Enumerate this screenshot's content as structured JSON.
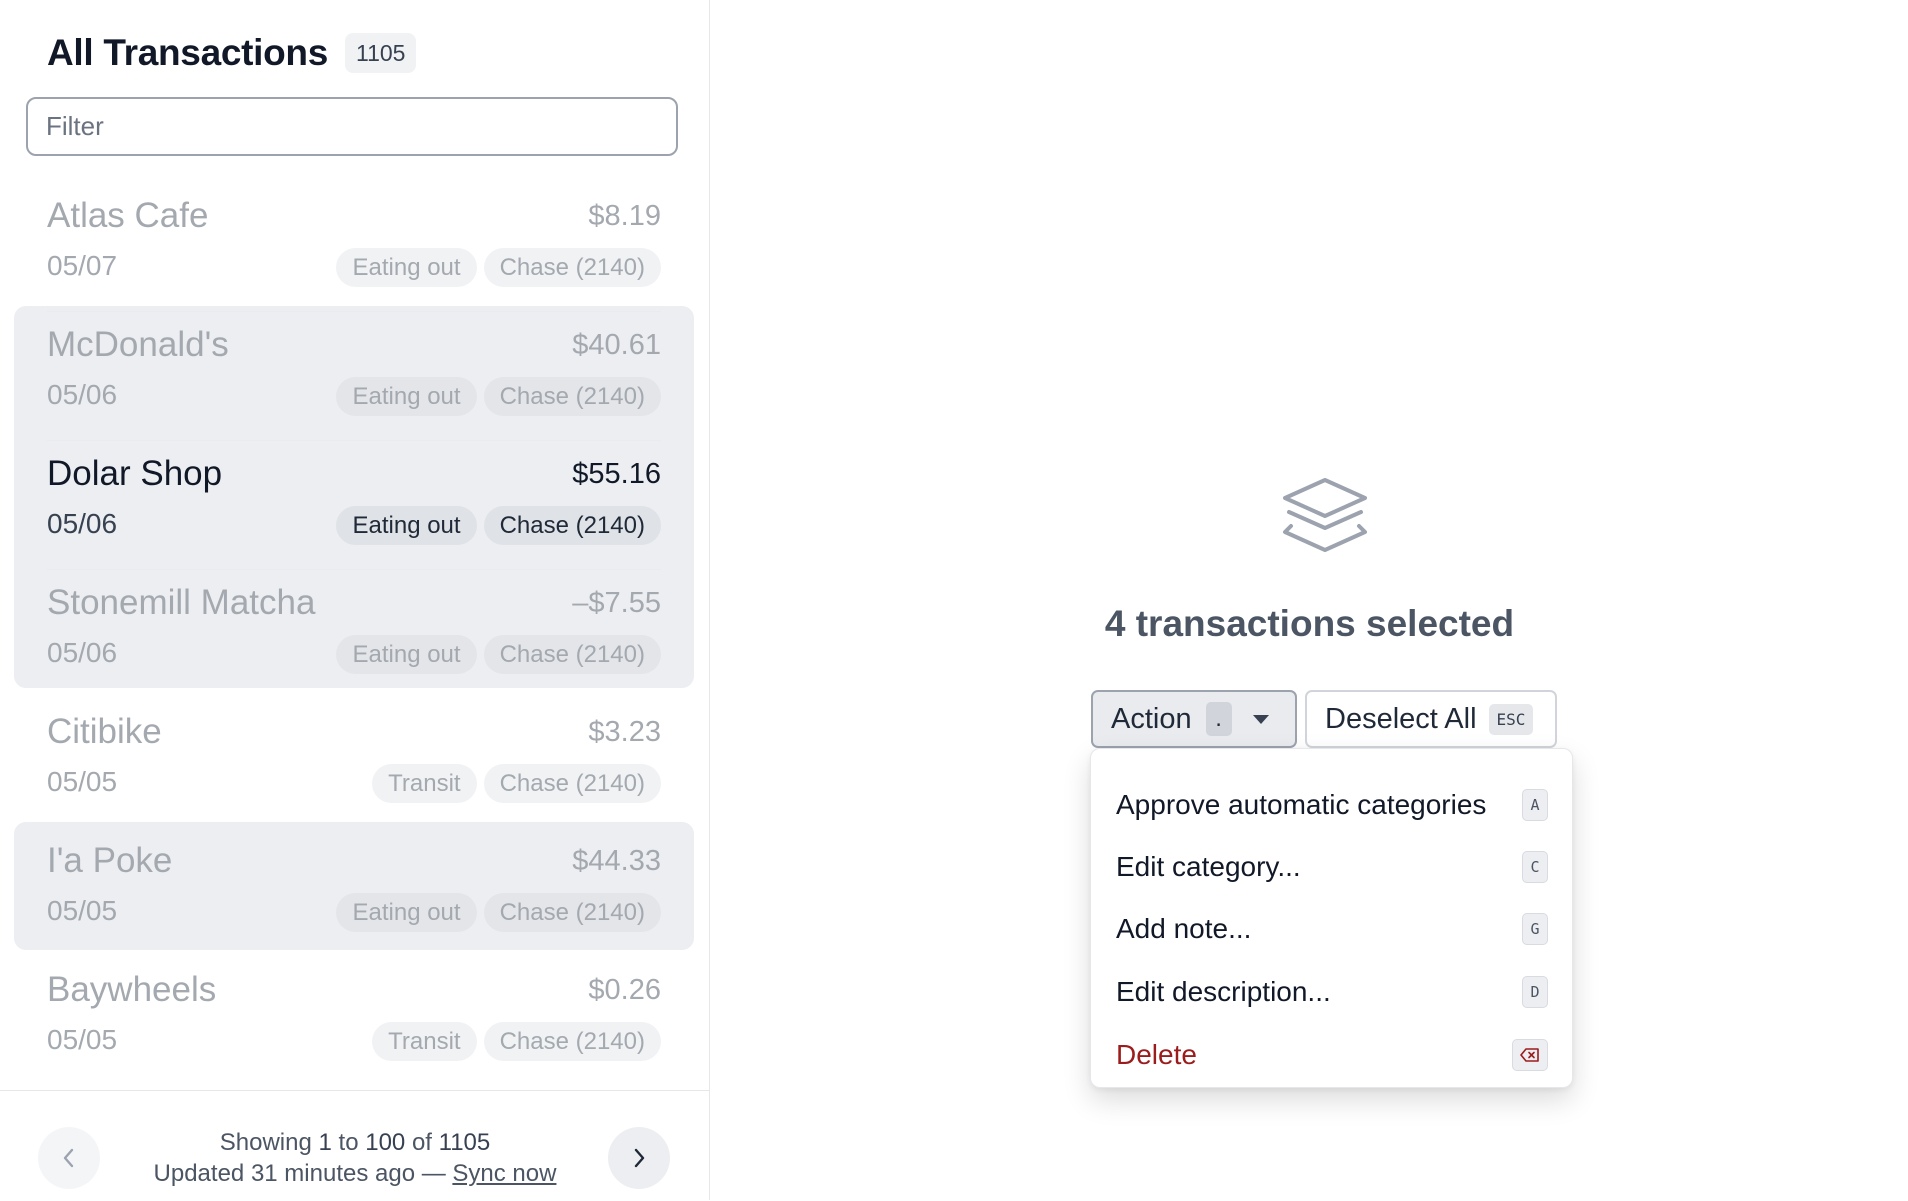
{
  "sidebar": {
    "title": "All Transactions",
    "count": "1105",
    "filter_placeholder": "Filter",
    "transactions": [
      {
        "merchant": "Atlas Cafe",
        "amount": "$8.19",
        "date": "05/07",
        "category": "Eating out",
        "account": "Chase (2140)"
      },
      {
        "merchant": "McDonald's",
        "amount": "$40.61",
        "date": "05/06",
        "category": "Eating out",
        "account": "Chase (2140)"
      },
      {
        "merchant": "Dolar Shop",
        "amount": "$55.16",
        "date": "05/06",
        "category": "Eating out",
        "account": "Chase (2140)"
      },
      {
        "merchant": "Stonemill Matcha",
        "amount": "–$7.55",
        "date": "05/06",
        "category": "Eating out",
        "account": "Chase (2140)"
      },
      {
        "merchant": "Citibike",
        "amount": "$3.23",
        "date": "05/05",
        "category": "Transit",
        "account": "Chase (2140)"
      },
      {
        "merchant": "I'a Poke",
        "amount": "$44.33",
        "date": "05/05",
        "category": "Eating out",
        "account": "Chase (2140)"
      },
      {
        "merchant": "Baywheels",
        "amount": "$0.26",
        "date": "05/05",
        "category": "Transit",
        "account": "Chase (2140)"
      }
    ],
    "footer": {
      "showing_prefix": "Showing",
      "range_start": "1",
      "to": "to",
      "range_end": "100",
      "of": "of",
      "total": "1105",
      "updated_text": "Updated 31 minutes ago —",
      "sync_label": "Sync now"
    }
  },
  "main": {
    "selected_text": "4 transactions selected",
    "action_label": "Action",
    "action_shortcut": ".",
    "deselect_label": "Deselect All",
    "deselect_shortcut": "ESC",
    "menu": [
      {
        "label": "Approve automatic categories",
        "shortcut": "A"
      },
      {
        "label": "Edit category...",
        "shortcut": "C"
      },
      {
        "label": "Add note...",
        "shortcut": "G"
      },
      {
        "label": "Edit description...",
        "shortcut": "D"
      },
      {
        "label": "Delete",
        "shortcut": ""
      }
    ]
  },
  "colors": {
    "danger": "#9b1c1c",
    "selection_bg": "#eceef1",
    "muted_text": "#a4a9b0"
  },
  "icons": [
    "layers-icon",
    "chevron-left-icon",
    "chevron-right-icon",
    "caret-down-icon",
    "backspace-icon"
  ]
}
